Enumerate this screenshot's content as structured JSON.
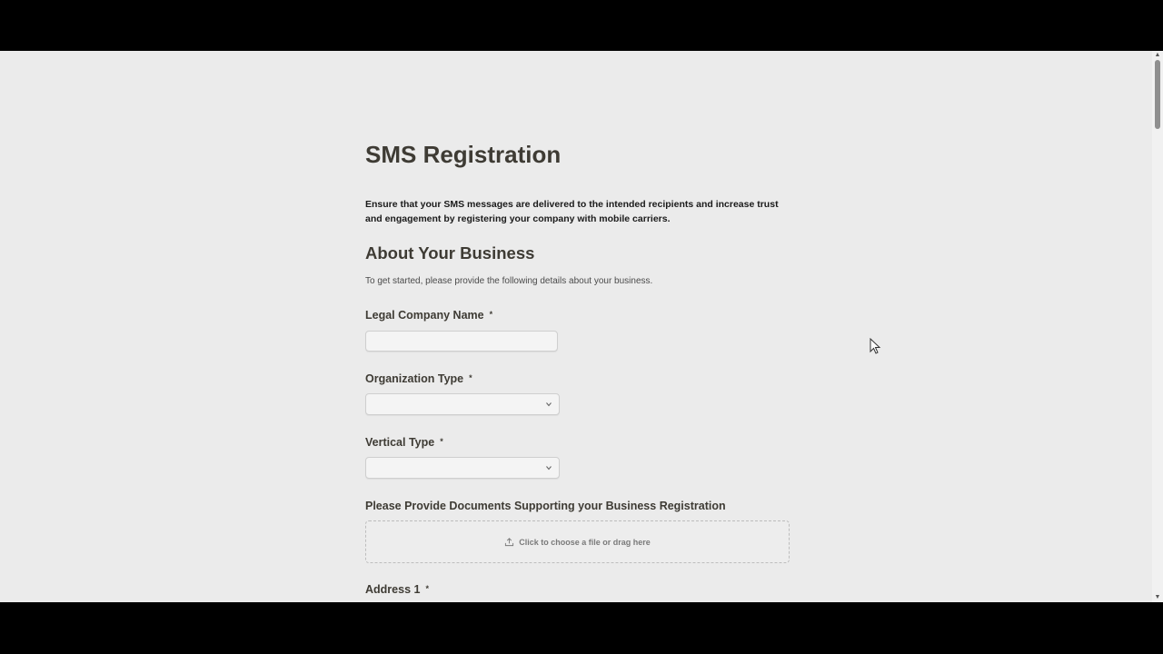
{
  "page": {
    "title": "SMS Registration",
    "intro": "Ensure that your SMS messages are delivered to the intended recipients and increase trust and engagement by registering your company with mobile carriers."
  },
  "section": {
    "title": "About Your Business",
    "description": "To get started, please provide the following details about your business."
  },
  "form": {
    "legal_company_name": {
      "label": "Legal Company Name",
      "required_mark": "*",
      "value": ""
    },
    "organization_type": {
      "label": "Organization Type",
      "required_mark": "*",
      "selected": ""
    },
    "vertical_type": {
      "label": "Vertical Type",
      "required_mark": "*",
      "selected": ""
    },
    "documents": {
      "label": "Please Provide Documents Supporting your Business Registration",
      "dropzone_text": "Click to choose a file or drag here"
    },
    "address1": {
      "label": "Address 1",
      "required_mark": "*"
    }
  },
  "icons": {
    "select_chevron": "chevron-down-icon",
    "upload": "upload-icon",
    "cursor": "mouse-pointer-icon"
  },
  "colors": {
    "background": "#ebebeb",
    "text": "#3e3b34",
    "frame": "#000000"
  }
}
